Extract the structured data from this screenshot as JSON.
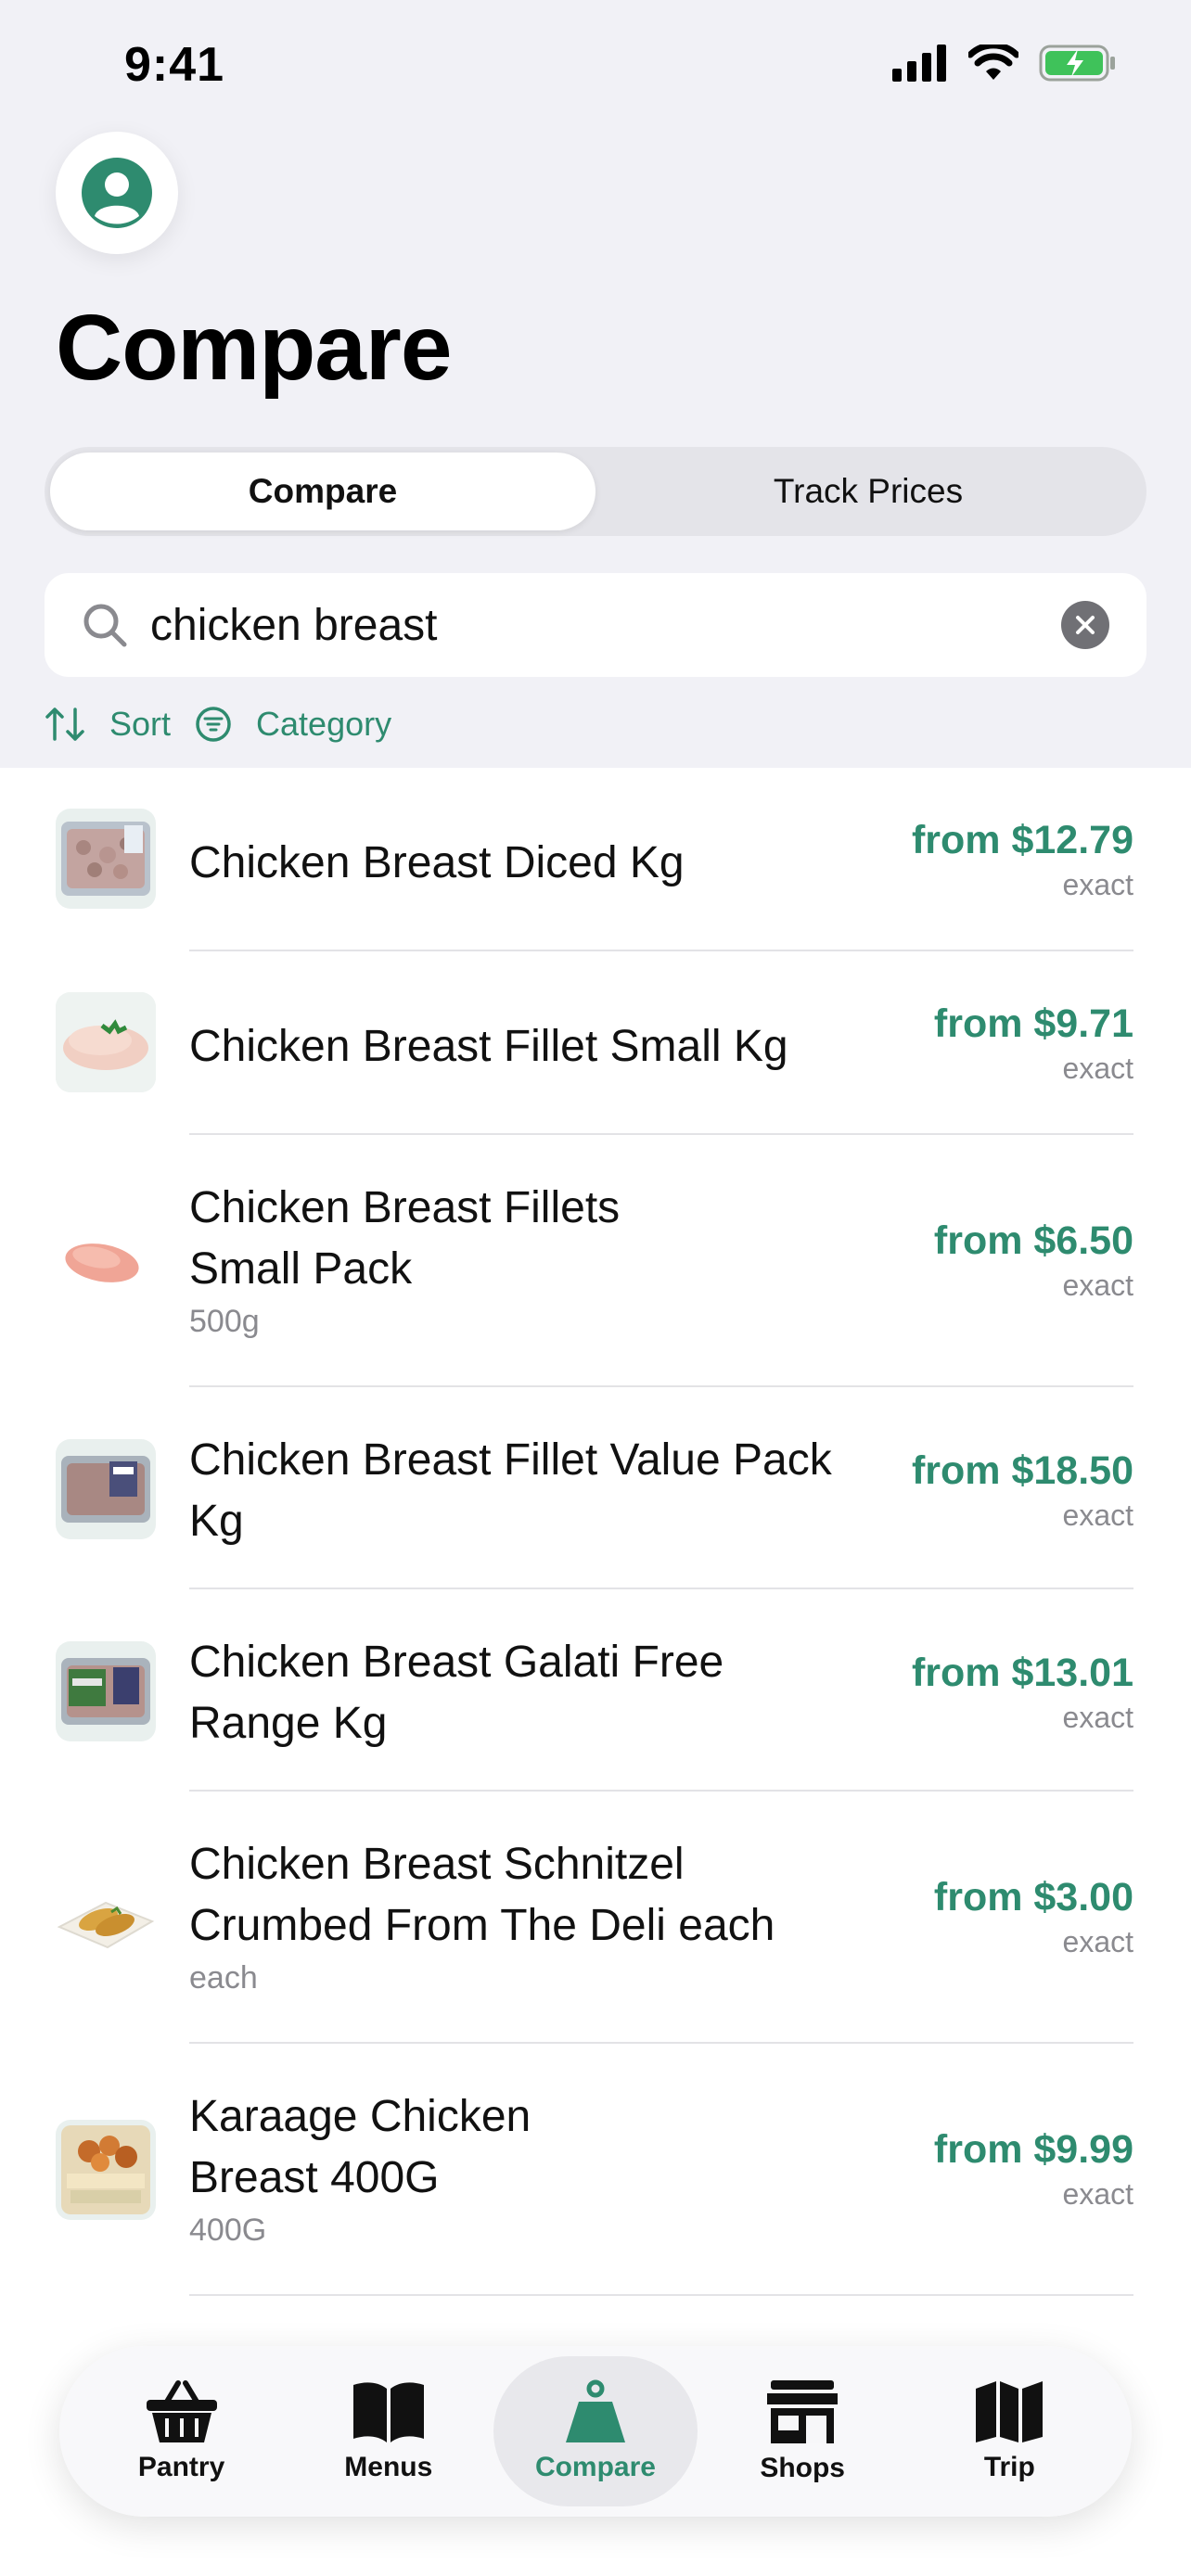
{
  "status_bar": {
    "time": "9:41"
  },
  "header": {
    "title": "Compare"
  },
  "segmented": {
    "left": "Compare",
    "right": "Track Prices"
  },
  "search": {
    "value": "chicken breast"
  },
  "filters": {
    "sort": "Sort",
    "category": "Category"
  },
  "results": [
    {
      "title": "Chicken Breast Diced Kg",
      "subtitle": "",
      "price": "from $12.79",
      "match": "exact",
      "image": "diced-chicken-pack"
    },
    {
      "title": "Chicken Breast Fillet Small Kg",
      "subtitle": "",
      "price": "from $9.71",
      "match": "exact",
      "image": "chicken-fillet-plate"
    },
    {
      "title": "Chicken Breast Fillets Small Pack",
      "subtitle": "500g",
      "price": "from $6.50",
      "match": "exact",
      "image": "raw-chicken-fillet"
    },
    {
      "title": "Chicken Breast Fillet Value Pack Kg",
      "subtitle": "",
      "price": "from $18.50",
      "match": "exact",
      "image": "value-pack-tray"
    },
    {
      "title": "Chicken Breast Galati Free Range Kg",
      "subtitle": "",
      "price": "from $13.01",
      "match": "exact",
      "image": "free-range-pack"
    },
    {
      "title": "Chicken Breast Schnitzel Crumbed From The Deli each",
      "subtitle": "each",
      "price": "from $3.00",
      "match": "exact",
      "image": "schnitzel-plate"
    },
    {
      "title": "Karaage Chicken Breast 400G",
      "subtitle": "400G",
      "price": "from $9.99",
      "match": "exact",
      "image": "karaage-box"
    }
  ],
  "tabbar": [
    {
      "label": "Pantry",
      "icon": "basket-icon"
    },
    {
      "label": "Menus",
      "icon": "book-icon"
    },
    {
      "label": "Compare",
      "icon": "scale-icon",
      "active": true
    },
    {
      "label": "Shops",
      "icon": "storefront-icon"
    },
    {
      "label": "Trip",
      "icon": "map-icon"
    }
  ],
  "colors": {
    "accent": "#2e8b6f",
    "background": "#f1f1f6"
  }
}
